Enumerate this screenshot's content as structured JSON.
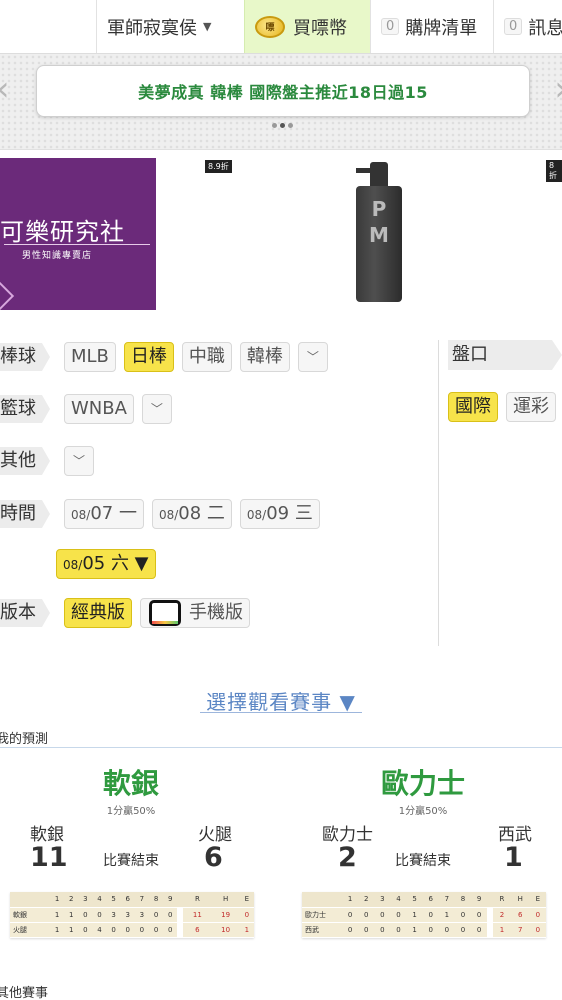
{
  "topnav": {
    "user_name": "軍師寂寞侯",
    "coin_icon_text": "嘌",
    "coin_label": "買嘌幣",
    "cart_count": "0",
    "cart_label": "購牌清單",
    "msg_count": "0",
    "msg_label": "訊息"
  },
  "announcement": {
    "text": "美夢成真 韓棒 國際盤主推近18日過15",
    "slide_index": 2,
    "slide_count": 3
  },
  "ads": [
    {
      "title": "可樂研究社",
      "subtitle": "男性知識專賣店",
      "bg": "#6b2a7a",
      "tag": "8.9折"
    },
    {
      "title": "PM",
      "tag": "8折"
    }
  ],
  "filters": {
    "baseball": {
      "label": "棒球",
      "options": [
        "MLB",
        "日棒",
        "中職",
        "韓棒"
      ],
      "selected": "日棒"
    },
    "basketball": {
      "label": "籃球",
      "options": [
        "WNBA"
      ]
    },
    "other": {
      "label": "其他"
    },
    "time": {
      "label": "時間",
      "dates": [
        {
          "md": "08/",
          "d": "07",
          "w": "一"
        },
        {
          "md": "08/",
          "d": "08",
          "w": "二"
        },
        {
          "md": "08/",
          "d": "09",
          "w": "三"
        }
      ],
      "selected": {
        "md": "08/",
        "d": "05",
        "w": "六 ▼"
      }
    },
    "version": {
      "label": "版本",
      "options": [
        "經典版",
        "手機版"
      ],
      "selected": "經典版"
    },
    "pankou": {
      "label": "盤口",
      "options": [
        "國際",
        "運彩"
      ],
      "selected": "國際"
    },
    "dropdown_glyph": "﹀"
  },
  "watch_link": "選擇觀看賽事 ▼",
  "prediction_label": "我的預測",
  "other_label": "其他賽事",
  "games": [
    {
      "pick": "軟銀",
      "rate": "1分贏50%",
      "away_team": "軟銀",
      "away_score": "11",
      "home_team": "火腿",
      "home_score": "6",
      "status": "比賽結束",
      "innings_header": [
        "1",
        "2",
        "3",
        "4",
        "5",
        "6",
        "7",
        "8",
        "9"
      ],
      "rhe_header": [
        "R",
        "H",
        "E"
      ],
      "rows": [
        {
          "team": "軟銀",
          "innings": [
            "1",
            "1",
            "0",
            "0",
            "3",
            "3",
            "3",
            "0",
            "0"
          ],
          "rhe": [
            "11",
            "19",
            "0"
          ]
        },
        {
          "team": "火腿",
          "innings": [
            "1",
            "1",
            "0",
            "4",
            "0",
            "0",
            "0",
            "0",
            "0"
          ],
          "rhe": [
            "6",
            "10",
            "1"
          ]
        }
      ]
    },
    {
      "pick": "歐力士",
      "rate": "1分贏50%",
      "away_team": "歐力士",
      "away_score": "2",
      "home_team": "西武",
      "home_score": "1",
      "status": "比賽結束",
      "innings_header": [
        "1",
        "2",
        "3",
        "4",
        "5",
        "6",
        "7",
        "8",
        "9"
      ],
      "rhe_header": [
        "R",
        "H",
        "E"
      ],
      "rows": [
        {
          "team": "歐力士",
          "innings": [
            "0",
            "0",
            "0",
            "0",
            "1",
            "0",
            "1",
            "0",
            "0"
          ],
          "rhe": [
            "2",
            "6",
            "0"
          ]
        },
        {
          "team": "西武",
          "innings": [
            "0",
            "0",
            "0",
            "0",
            "1",
            "0",
            "0",
            "0",
            "0"
          ],
          "rhe": [
            "1",
            "7",
            "0"
          ]
        }
      ]
    }
  ]
}
